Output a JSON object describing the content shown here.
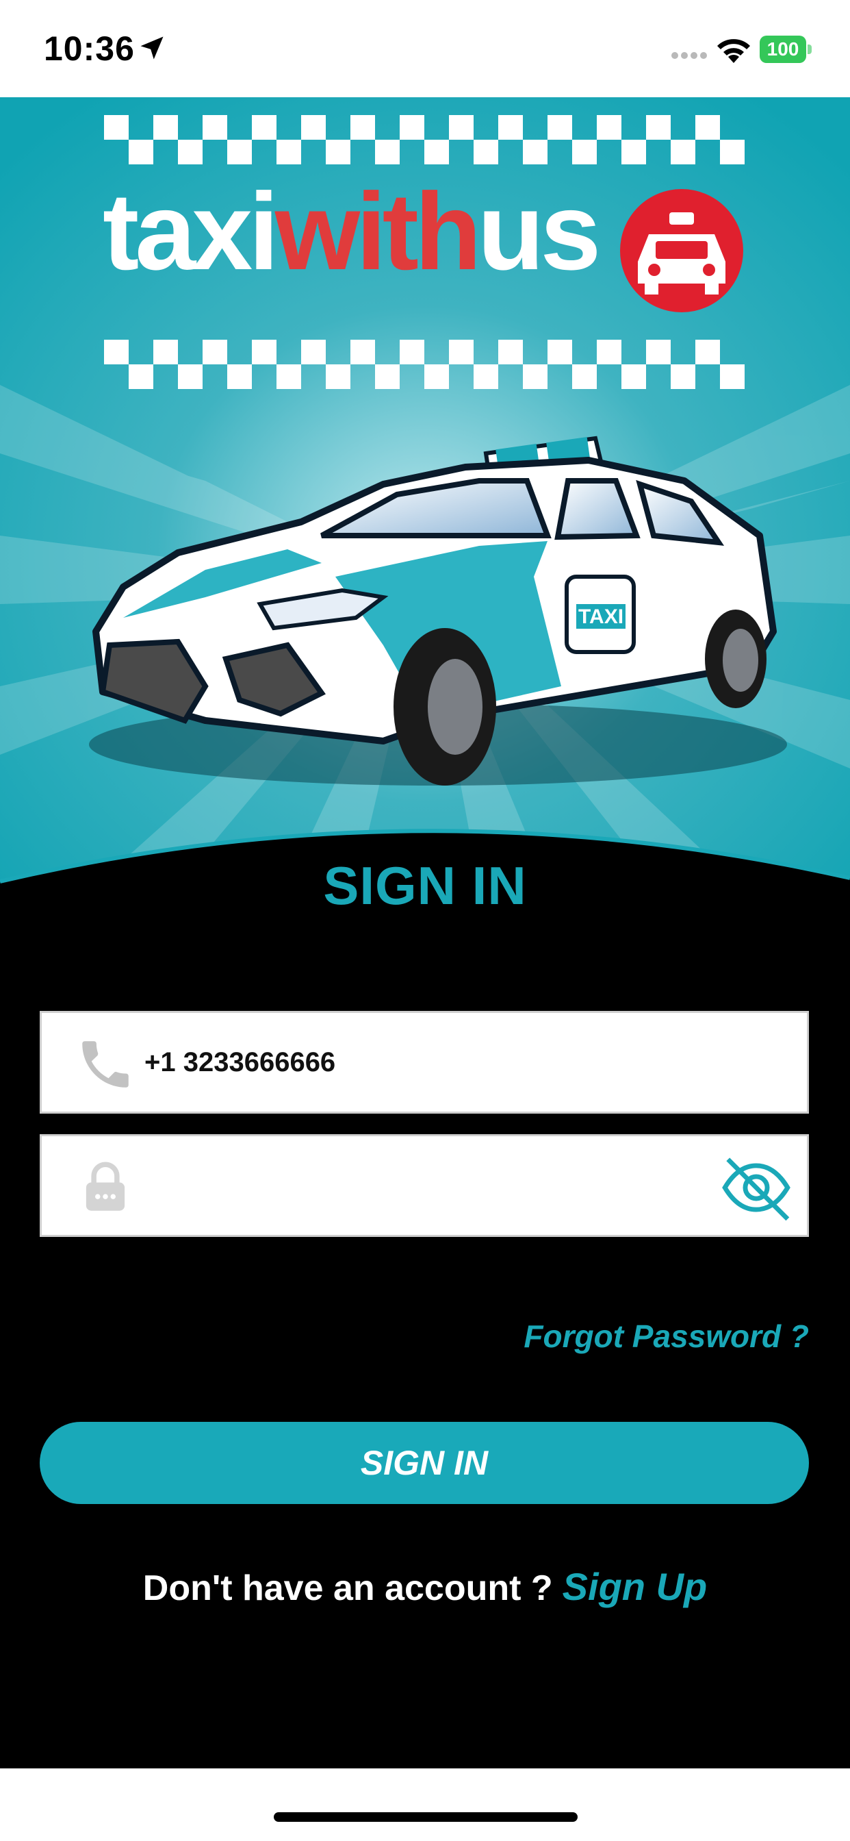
{
  "status_bar": {
    "time": "10:36",
    "battery": "100",
    "location_icon": "location-arrow-icon",
    "wifi_icon": "wifi-icon"
  },
  "brand": {
    "logo_parts": [
      "taxi",
      "with",
      "us"
    ],
    "logo_icon": "taxi-car-icon",
    "accent_color": "#1aa8b8",
    "logo_red": "#e03c3c",
    "taxi_sign_text": "TAXI"
  },
  "form": {
    "title": "SIGN IN",
    "phone": {
      "value": "+1 3233666666",
      "icon": "phone-icon"
    },
    "password": {
      "value": "",
      "icon": "lock-icon",
      "toggle_icon": "eye-slash-icon"
    },
    "forgot_password": "Forgot Password ?",
    "submit_label": "SIGN IN"
  },
  "signup": {
    "prompt": "Don't have an account ?",
    "link": "Sign Up"
  }
}
